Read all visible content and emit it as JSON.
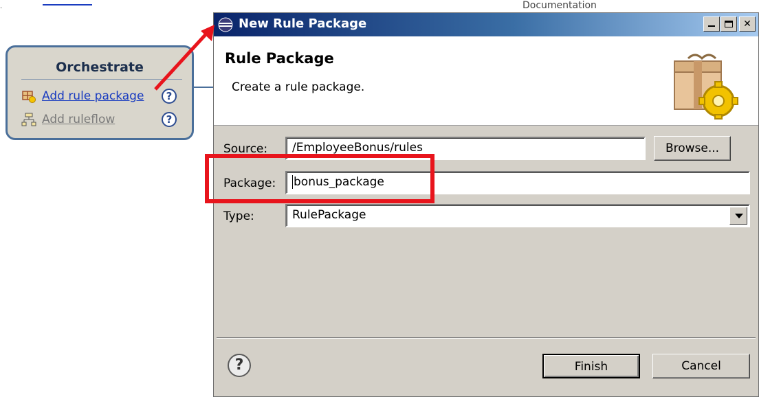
{
  "background": {
    "tab_text": "Documentation"
  },
  "orchestrate_panel": {
    "title": "Orchestrate",
    "items": [
      {
        "label": "Add rule package",
        "enabled": true,
        "icon": "rule-package-icon"
      },
      {
        "label": "Add ruleflow",
        "enabled": false,
        "icon": "ruleflow-icon"
      }
    ],
    "help_glyph": "?"
  },
  "dialog": {
    "title": "New Rule Package",
    "header": {
      "title": "Rule Package",
      "description": "Create a rule package."
    },
    "form": {
      "source_label": "Source:",
      "source_value": "/EmployeeBonus/rules",
      "browse_label": "Browse...",
      "package_label": "Package:",
      "package_value": "bonus_package",
      "type_label": "Type:",
      "type_value": "RulePackage"
    },
    "footer": {
      "help_glyph": "?",
      "finish_label": "Finish",
      "cancel_label": "Cancel"
    }
  },
  "colors": {
    "annotation": "#e8141c",
    "title_bar_start": "#0a246a",
    "link": "#1a3cc0",
    "panel_border": "#4a6f9a"
  }
}
